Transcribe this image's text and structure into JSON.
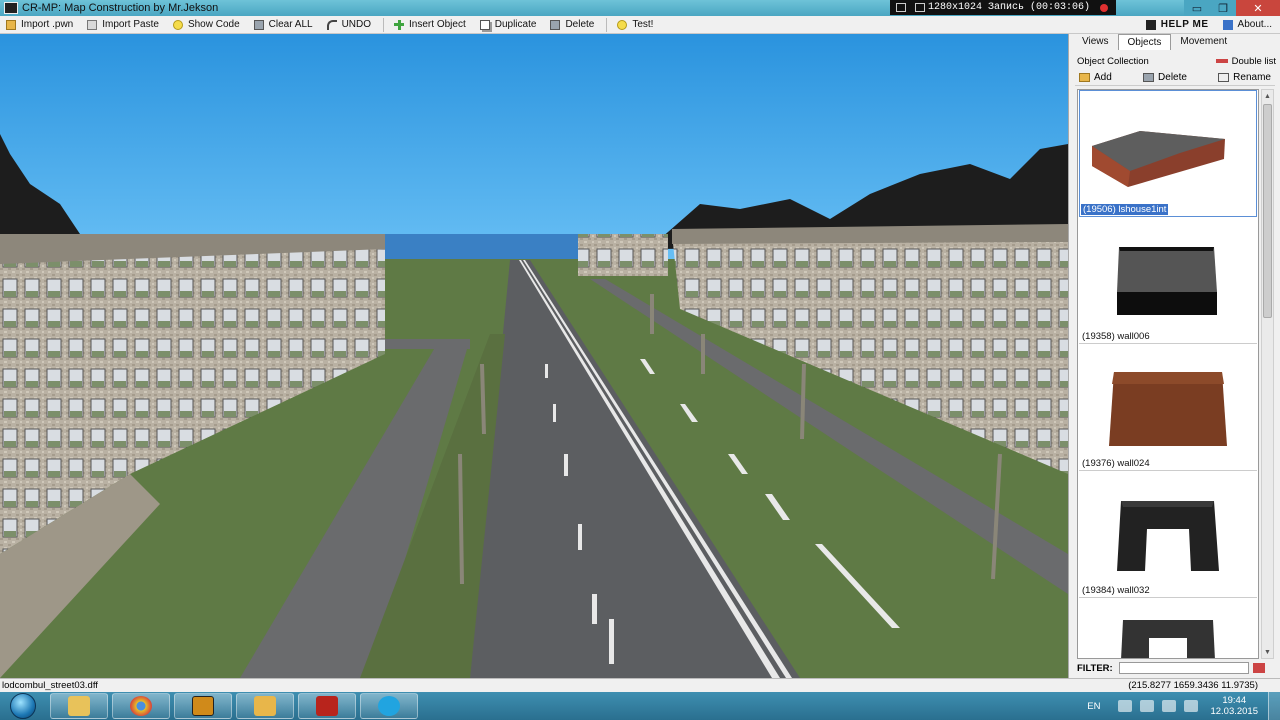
{
  "window": {
    "title": "CR-MP: Map Construction by Mr.Jekson",
    "controls": {
      "minimize": "▭",
      "maximize": "❐",
      "close": "✕"
    }
  },
  "recorder": {
    "resolution": "1280x1024",
    "status": "Запись (00:03:06)"
  },
  "toolbar": {
    "items": [
      {
        "label": "Import .pwn",
        "icon": "folder-icon"
      },
      {
        "label": "Import Paste",
        "icon": "paste-icon"
      },
      {
        "label": "Show Code",
        "icon": "bulb-icon"
      },
      {
        "label": "Clear ALL",
        "icon": "trash-icon"
      },
      {
        "label": "UNDO",
        "icon": "undo-icon"
      },
      {
        "label": "Insert Object",
        "icon": "plus-icon"
      },
      {
        "label": "Duplicate",
        "icon": "duplicate-icon"
      },
      {
        "label": "Delete",
        "icon": "trash-icon"
      },
      {
        "label": "Test!",
        "icon": "bulb-icon"
      }
    ],
    "help": "HELP ME",
    "about": "About..."
  },
  "panel": {
    "tabs": [
      "Views",
      "Objects",
      "Movement"
    ],
    "active_tab": "Objects",
    "group_label": "Object Collection",
    "double_list": "Double list",
    "actions": {
      "add": "Add",
      "delete": "Delete",
      "rename": "Rename"
    },
    "objects": [
      {
        "caption": "(19506) lshouse1int",
        "selected": true
      },
      {
        "caption": "(19358) wall006",
        "selected": false
      },
      {
        "caption": "(19376) wall024",
        "selected": false
      },
      {
        "caption": "(19384) wall032",
        "selected": false
      },
      {
        "caption": "",
        "selected": false
      }
    ],
    "filter_label": "FILTER:",
    "filter_value": ""
  },
  "status": {
    "file": "lodcombul_street03.dff",
    "coords": "(215.8277 1659.3436 11.9735)"
  },
  "taskbar": {
    "apps": [
      "explorer",
      "chrome",
      "map-editor",
      "folder",
      "filezilla",
      "skype"
    ],
    "lang": "EN",
    "time": "19:44",
    "date": "12.03.2015"
  }
}
